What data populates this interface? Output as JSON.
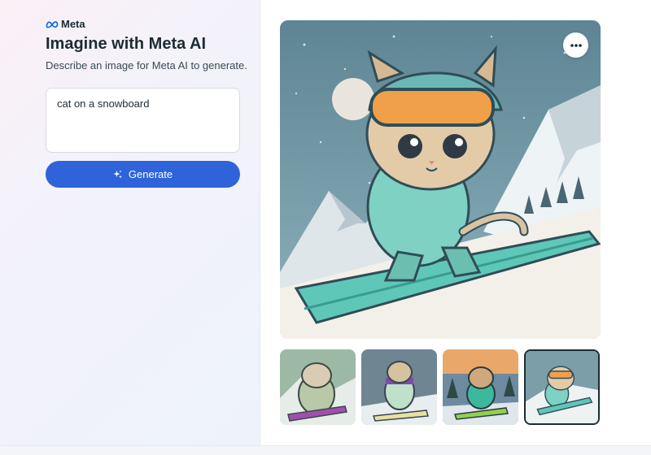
{
  "brand": {
    "name": "Meta"
  },
  "header": {
    "title": "Imagine with Meta AI",
    "subtitle": "Describe an image for Meta AI to generate."
  },
  "prompt": {
    "value": "cat on a snowboard"
  },
  "generate_button": {
    "label": "Generate"
  },
  "main_image": {
    "description": "cat on a snowboard",
    "more_icon": "more-horizontal-icon"
  },
  "thumbnails": [
    {
      "alt": "cat on a snowboard variant 1",
      "selected": false
    },
    {
      "alt": "cat on a snowboard variant 2",
      "selected": false
    },
    {
      "alt": "cat on a snowboard variant 3",
      "selected": false
    },
    {
      "alt": "cat on a snowboard variant 4",
      "selected": true
    }
  ],
  "colors": {
    "accent": "#2e63d9",
    "text": "#1c2b33"
  }
}
